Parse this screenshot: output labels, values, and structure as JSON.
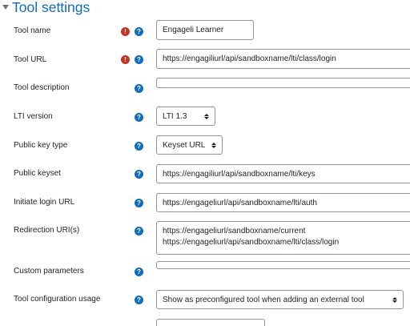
{
  "section": {
    "title": "Tool settings"
  },
  "colors": {
    "accent": "#0f6cbf",
    "required": "#ca3120",
    "border": "#8f959e"
  },
  "fields": {
    "tool_name": {
      "label": "Tool name",
      "value": "Engageli Learner",
      "required": true
    },
    "tool_url": {
      "label": "Tool URL",
      "value": "https://engagiliurl/api/sandboxname/lti/class/login",
      "required": true
    },
    "tool_description": {
      "label": "Tool description",
      "value": ""
    },
    "lti_version": {
      "label": "LTI version",
      "value": "LTI 1.3"
    },
    "public_key_type": {
      "label": "Public key type",
      "value": "Keyset URL"
    },
    "public_keyset": {
      "label": "Public keyset",
      "value": "https://engagiliurl/api/sandboxname/lti/keys"
    },
    "initiate_login_url": {
      "label": "Initiate login URL",
      "value": "https://engageliurl/api/sandboxname/lti/auth"
    },
    "redirection_uris": {
      "label": "Redirection URI(s)",
      "line1": "https://engageliurl/sandboxname/current",
      "line2": "https://engageliurl/api/sandboxname/lti/class/login"
    },
    "custom_parameters": {
      "label": "Custom parameters",
      "value": ""
    },
    "tool_configuration_usage": {
      "label": "Tool configuration usage",
      "value": "Show as preconfigured tool when adding an external tool"
    }
  },
  "icons": {
    "required": "exclamation-circle-icon",
    "help": "question-circle-icon",
    "caret": "caret-down-icon"
  },
  "glyphs": {
    "required": "!",
    "help": "?"
  }
}
